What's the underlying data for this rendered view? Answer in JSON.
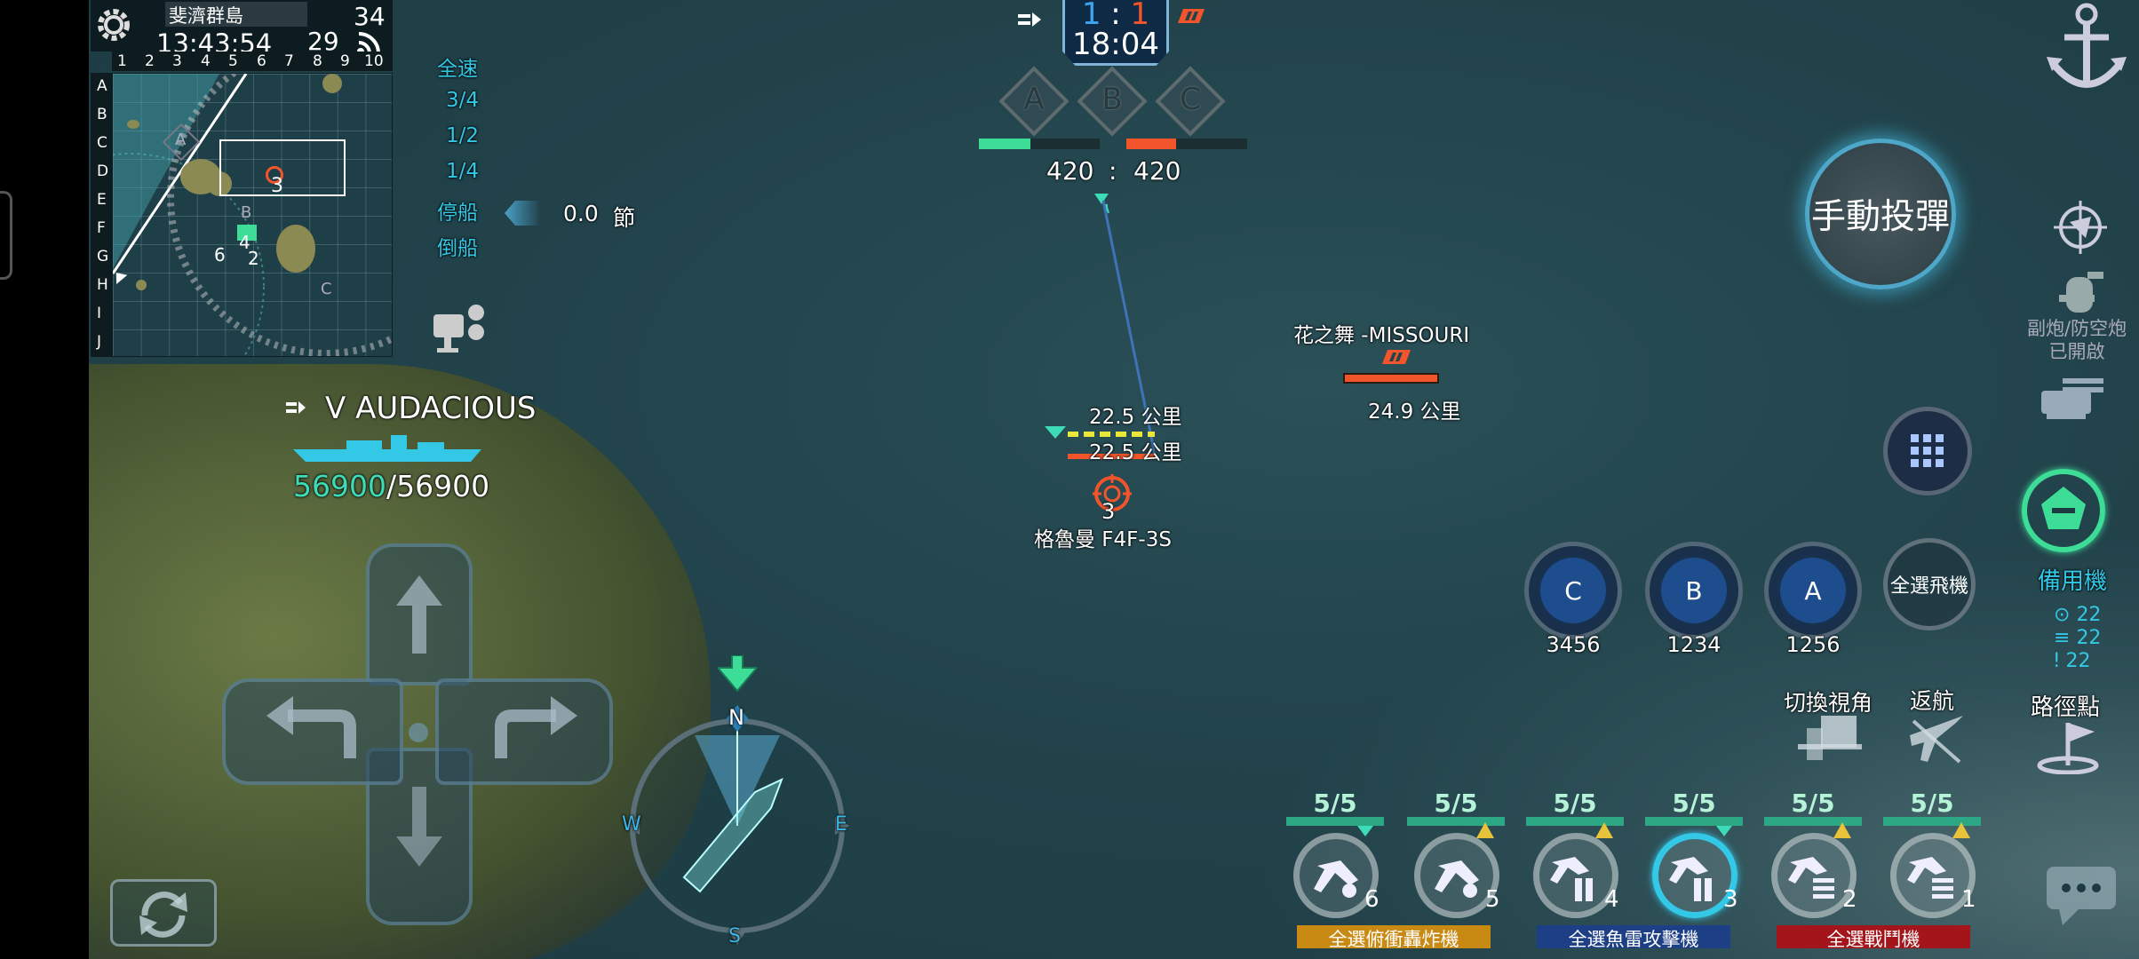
{
  "hud": {
    "map_name": "斐濟群島",
    "clock": "13:43:54",
    "ping": "34",
    "fps": "29",
    "minimap_rows": [
      "A",
      "B",
      "C",
      "D",
      "E",
      "F",
      "G",
      "H",
      "I",
      "J"
    ],
    "minimap_cols": [
      "1",
      "2",
      "3",
      "4",
      "5",
      "6",
      "7",
      "8",
      "9",
      "10"
    ],
    "minimap_markers": {
      "a": "A",
      "b": "B",
      "c": "C",
      "n3": "3",
      "n4": "4",
      "n6": "6",
      "n2": "2"
    }
  },
  "speed": {
    "options": [
      "全速",
      "3/4",
      "1/2",
      "1/4",
      "停船",
      "倒船"
    ],
    "value": "0.0",
    "unit": "節"
  },
  "player_ship": {
    "name": "V AUDACIOUS",
    "hp_current": "56900",
    "hp_max": "/56900"
  },
  "score": {
    "team_left": "1",
    "sep": ":",
    "team_right": "1",
    "timer": "18:04",
    "capture_points": [
      "A",
      "B",
      "C"
    ],
    "points_left": "420",
    "points_sep": ":",
    "points_right": "420"
  },
  "targets": {
    "enemy_ship_name": "花之舞 -MISSOURI",
    "enemy_ship_distance": "24.9 公里",
    "dist_1": "22.5 公里",
    "dist_2": "22.5 公里",
    "enemy_air_count": "3",
    "enemy_air_name": "格魯曼 F4F-3S"
  },
  "compass": {
    "n": "N",
    "e": "E",
    "s": "S",
    "w": "W"
  },
  "right_panel": {
    "manual_drop": "手動投彈",
    "secondary_guns_line1": "副炮/防空炮",
    "secondary_guns_line2": "已開啟",
    "reserve_planes": "備用機",
    "reserve_counts": [
      "22",
      "22",
      "22"
    ],
    "waypoint": "路徑點",
    "switch_view": "切換視角",
    "return": "返航",
    "select_all_planes": "全選飛機"
  },
  "groups": [
    {
      "letter": "C",
      "ids": "3456"
    },
    {
      "letter": "B",
      "ids": "1234"
    },
    {
      "letter": "A",
      "ids": "1256"
    }
  ],
  "squadrons": [
    {
      "count": "5/5",
      "num": "6"
    },
    {
      "count": "5/5",
      "num": "5"
    },
    {
      "count": "5/5",
      "num": "4"
    },
    {
      "count": "5/5",
      "num": "3"
    },
    {
      "count": "5/5",
      "num": "2"
    },
    {
      "count": "5/5",
      "num": "1"
    }
  ],
  "squadron_groups": {
    "dive_bombers": "全選俯衝轟炸機",
    "torpedo_bombers": "全選魚雷攻擊機",
    "fighters": "全選戰鬥機"
  },
  "colors": {
    "ally": "#3ddc97",
    "enemy": "#f2552c",
    "accent": "#33c8e6",
    "dive": "#c98a14",
    "torpedo": "#1d3f86",
    "fighter": "#a3141b"
  }
}
